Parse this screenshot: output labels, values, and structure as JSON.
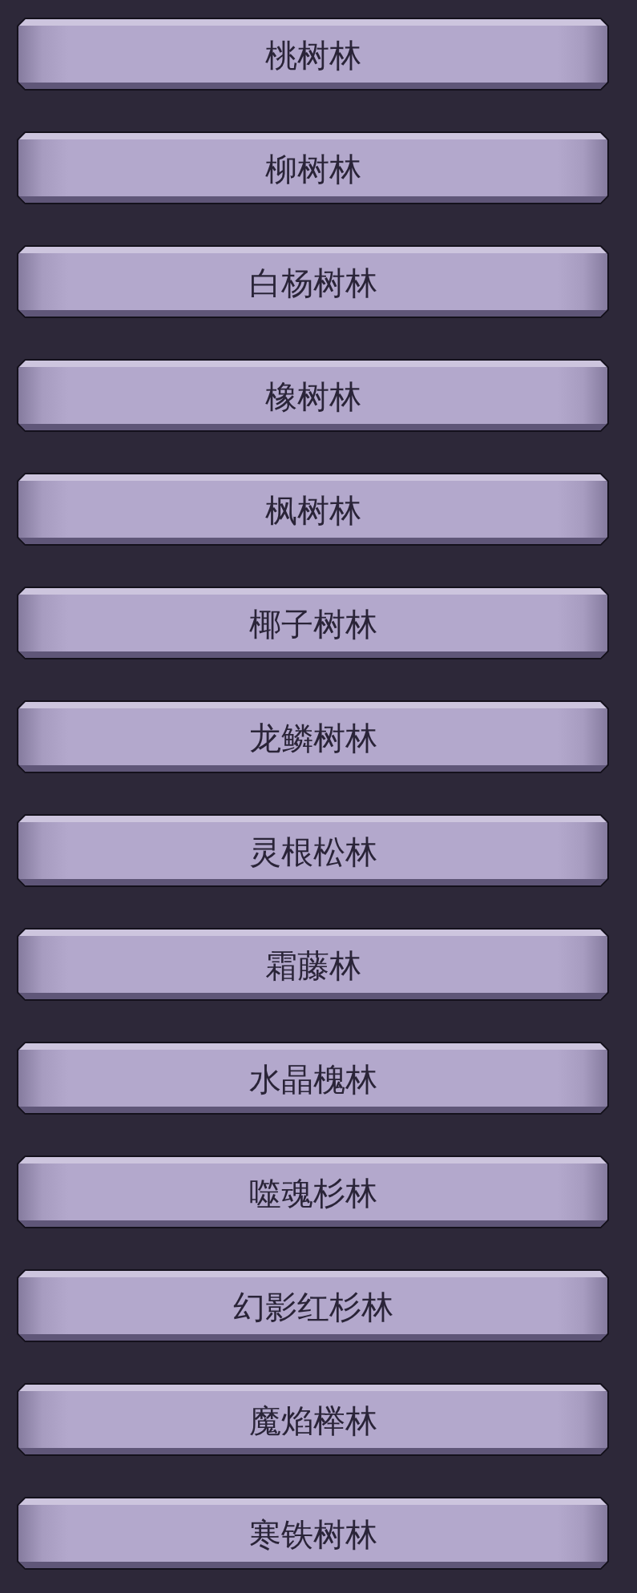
{
  "buttons": [
    {
      "label": "桃树林"
    },
    {
      "label": "柳树林"
    },
    {
      "label": "白杨树林"
    },
    {
      "label": "橡树林"
    },
    {
      "label": "枫树林"
    },
    {
      "label": "椰子树林"
    },
    {
      "label": "龙鳞树林"
    },
    {
      "label": "灵根松林"
    },
    {
      "label": "霜藤林"
    },
    {
      "label": "水晶槐林"
    },
    {
      "label": "噬魂杉林"
    },
    {
      "label": "幻影红杉林"
    },
    {
      "label": "魔焰榉林"
    },
    {
      "label": "寒铁树林"
    }
  ]
}
